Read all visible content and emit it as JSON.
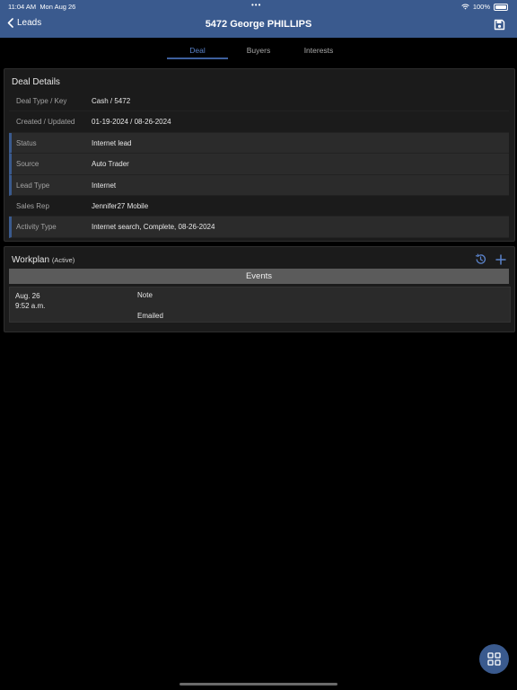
{
  "status_bar": {
    "time": "11:04 AM",
    "date": "Mon Aug 26",
    "dots": "•••",
    "battery": "100%"
  },
  "nav": {
    "back_label": "Leads",
    "title": "5472 George PHILLIPS"
  },
  "tabs": [
    {
      "label": "Deal",
      "active": true
    },
    {
      "label": "Buyers",
      "active": false
    },
    {
      "label": "Interests",
      "active": false
    }
  ],
  "deal_details": {
    "title": "Deal Details",
    "rows": [
      {
        "label": "Deal Type / Key",
        "value": "Cash / 5472"
      },
      {
        "label": "Created / Updated",
        "value": "01-19-2024 / 08-26-2024"
      },
      {
        "label": "Status",
        "value": "Internet lead"
      },
      {
        "label": "Source",
        "value": "Auto Trader"
      },
      {
        "label": "Lead Type",
        "value": "Internet"
      },
      {
        "label": "Sales Rep",
        "value": "Jennifer27 Mobile"
      },
      {
        "label": "Activity Type",
        "value": "Internet search, Complete, 08-26-2024"
      }
    ]
  },
  "workplan": {
    "title": "Workplan",
    "subtitle": "(Active)",
    "events_header": "Events",
    "events": [
      {
        "date": "Aug. 26",
        "time": "9:52 a.m.",
        "type": "Note",
        "status": "Emailed"
      }
    ]
  },
  "icons": {
    "wifi": "wifi-icon",
    "battery": "battery-icon",
    "back": "chevron-left-icon",
    "save": "save-icon",
    "history": "history-icon",
    "add": "plus-icon",
    "fab": "grid-icon"
  },
  "colors": {
    "accent": "#3a5a8e",
    "active_tab": "#5a82c9",
    "background": "#000000",
    "card": "#1b1b1b"
  }
}
